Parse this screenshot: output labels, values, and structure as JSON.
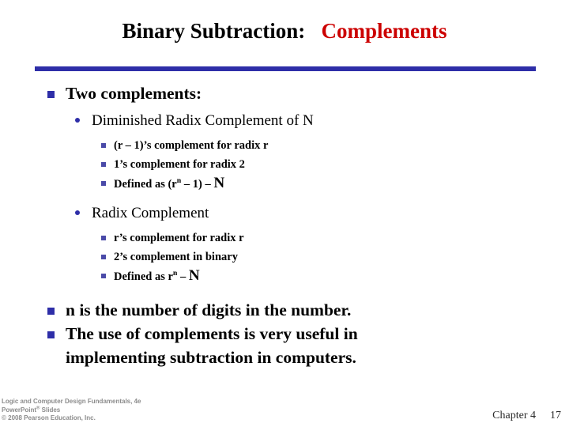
{
  "slide": {
    "title": {
      "main": "Binary Subtraction:",
      "accent": "Complements",
      "accent_color": "#CC0000",
      "main_color": "#000000"
    },
    "rule_color": "#2E2EA8",
    "bullet_color": "#2E2EA8",
    "content": {
      "heading": "Two complements:",
      "group_one": {
        "label": "Diminished Radix Complement of N",
        "items": [
          "(r – 1)’s complement for radix r",
          "1’s complement for radix 2"
        ],
        "defined_prefix": "Defined as (r",
        "defined_exponent": "n",
        "defined_middle": " – 1) – ",
        "defined_operand": "N"
      },
      "group_two": {
        "label": "Radix Complement",
        "items": [
          "r’s complement for radix r",
          "2’s complement in binary"
        ],
        "defined_prefix": "Defined as r",
        "defined_exponent": "n",
        "defined_middle": " – ",
        "defined_operand": "N"
      },
      "closing": {
        "line_n": "n is the number of digits in the number.",
        "line_use_1": "The use of complements is very useful in",
        "line_use_2": "implementing subtraction in computers."
      }
    }
  },
  "footer": {
    "credit_line_1": "Logic and Computer Design Fundamentals, 4e",
    "credit_line_2_main": "PowerPoint",
    "credit_line_2_reg": "®",
    "credit_line_2_tail": " Slides",
    "credit_line_3": "© 2008 Pearson Education, Inc.",
    "chapter": "Chapter 4",
    "page_number": "17"
  }
}
